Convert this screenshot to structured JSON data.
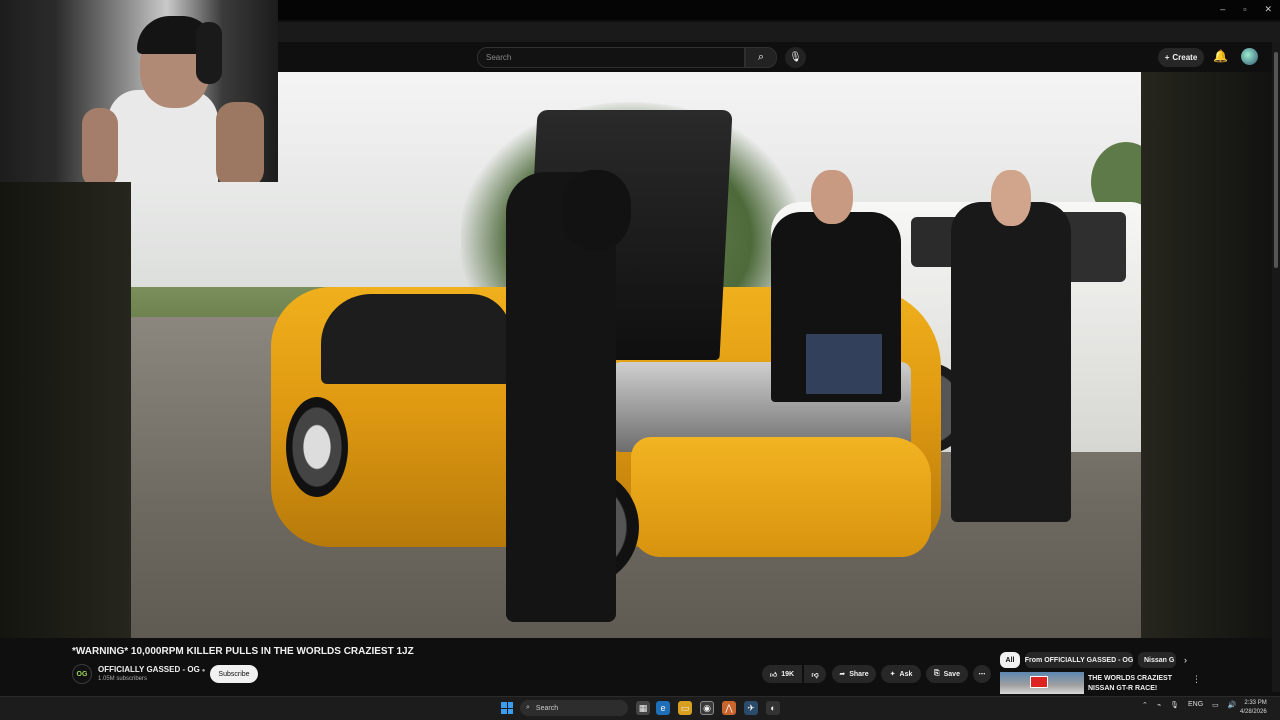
{
  "browser": {
    "window_controls": [
      "–",
      "▫",
      "✕"
    ]
  },
  "masthead": {
    "search_placeholder": "Search",
    "create_label": "Create"
  },
  "video": {
    "title": "*WARNING* 10,000RPM KILLER PULLS IN THE WORLDS CRAZIEST 1JZ",
    "channel_name": "OFFICIALLY GASSED - OG",
    "channel_avatar_text": "OG",
    "subscribers": "1.05M subscribers",
    "subscribe_label": "Subscribe"
  },
  "actions": {
    "like_count": "19K",
    "share_label": "Share",
    "ask_label": "Ask",
    "save_label": "Save",
    "more_label": "⋯"
  },
  "chips": [
    "All",
    "From OFFICIALLY GASSED - OG",
    "Nissan G"
  ],
  "recommendation": {
    "title": "THE WORLDS CRAZIEST NISSAN GT-R RACE!"
  },
  "taskbar": {
    "search_label": "Search",
    "language": "ENG",
    "time": "2:33 PM",
    "date": "4/28/2026"
  },
  "icons": {
    "search": "search-icon",
    "mic": "mic-icon",
    "bell": "bell-icon",
    "like": "thumbs-up-icon",
    "dislike": "thumbs-down-icon",
    "share": "share-icon",
    "ask": "sparkle-icon",
    "save": "bookmark-icon"
  },
  "colors": {
    "background": "#0f0f0f",
    "pill": "#272727",
    "subscribe_bg": "#f1f1f1",
    "car": "#e09a12",
    "taskbar": "#1c1c1c"
  }
}
